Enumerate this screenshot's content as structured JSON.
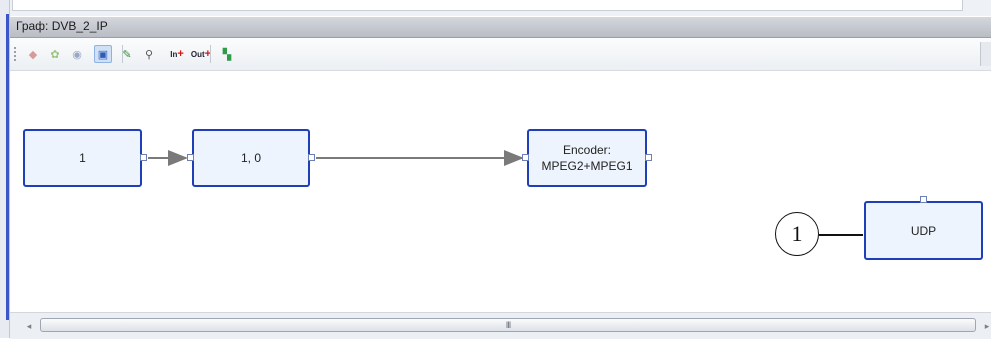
{
  "window": {
    "title": "Граф: DVB_2_IP"
  },
  "toolbar": {
    "buttons": [
      {
        "icon": "diamond-icon",
        "glyph": "◆",
        "color": "#d99a9a",
        "active": false
      },
      {
        "icon": "gear-icon",
        "glyph": "✿",
        "color": "#9bc37e",
        "active": false
      },
      {
        "icon": "shield-icon",
        "glyph": "◉",
        "color": "#9aa8c6",
        "active": false
      },
      {
        "icon": "select-icon",
        "glyph": "▣",
        "color": "#2f5bb7",
        "active": true
      },
      {
        "icon": "brush-icon",
        "glyph": "✎",
        "color": "#3c8a3c",
        "active": false
      },
      {
        "icon": "connect-icon",
        "glyph": "⚲",
        "color": "#555555",
        "active": false
      },
      {
        "icon": "add-input-icon",
        "text": "In",
        "color": "#d11",
        "active": false
      },
      {
        "icon": "add-output-icon",
        "text": "Out",
        "color": "#d11",
        "active": false
      },
      {
        "icon": "layout-icon",
        "glyph": "▚",
        "color": "#2e9a4a",
        "active": false
      }
    ]
  },
  "graph": {
    "nodes": [
      {
        "id": "n1",
        "label": "1"
      },
      {
        "id": "n2",
        "label": "1, 0"
      },
      {
        "id": "n3",
        "label": "Encoder:\nMPEG2+MPEG1"
      },
      {
        "id": "n4",
        "label": "UDP"
      }
    ],
    "edges": [
      {
        "from": "n1",
        "to": "n2"
      },
      {
        "from": "n2",
        "to": "n3"
      }
    ]
  },
  "callout": {
    "number": "1"
  },
  "scrollbar": {
    "left_arrow": "◂",
    "right_arrow": "▸",
    "thumb": "III"
  },
  "colors": {
    "node_border": "#1f3fb8",
    "node_fill": "#eef4fd",
    "edge": "#7a7a7a",
    "title_bar": "#c4c8ce"
  }
}
